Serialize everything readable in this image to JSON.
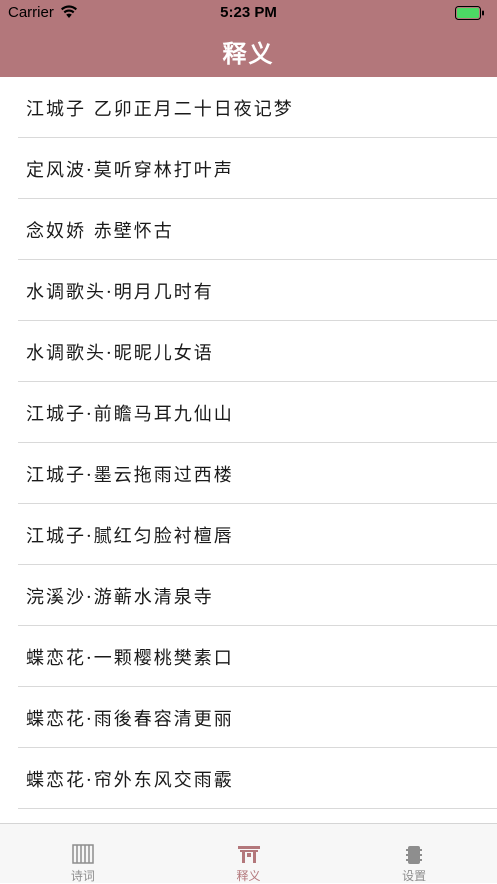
{
  "status_bar": {
    "carrier": "Carrier",
    "time": "5:23 PM"
  },
  "nav": {
    "title": "释义"
  },
  "list": {
    "items": [
      "江城子 乙卯正月二十日夜记梦",
      "定风波·莫听穿林打叶声",
      "念奴娇 赤壁怀古",
      "水调歌头·明月几时有",
      "水调歌头·昵昵儿女语",
      "江城子·前瞻马耳九仙山",
      "江城子·墨云拖雨过西楼",
      "江城子·腻红匀脸衬檀唇",
      "浣溪沙·游蕲水清泉寺",
      "蝶恋花·一颗樱桃樊素口",
      "蝶恋花·雨後春容清更丽",
      "蝶恋花·帘外东风交雨霰"
    ]
  },
  "tab_bar": {
    "tabs": [
      {
        "label": "诗词",
        "icon": "book-icon"
      },
      {
        "label": "释义",
        "icon": "gate-icon"
      },
      {
        "label": "设置",
        "icon": "gear-icon"
      }
    ],
    "active_index": 1
  },
  "colors": {
    "accent": "#b3777b",
    "battery": "#4cd964",
    "tab_inactive": "#8e8e8e"
  }
}
